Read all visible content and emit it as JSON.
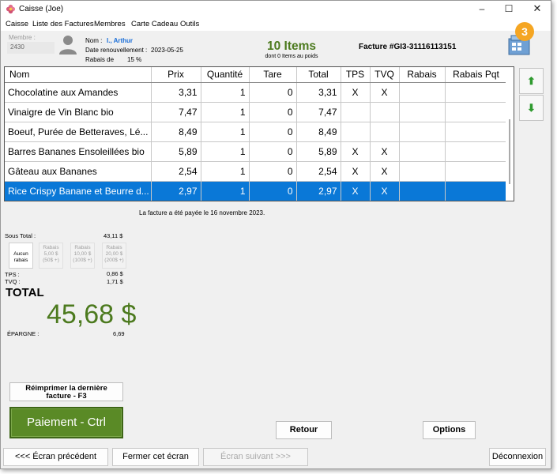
{
  "window": {
    "title": "Caisse (Joe)",
    "minimize": "–",
    "maximize": "☐",
    "close": "✕"
  },
  "menu": [
    "Caisse",
    "Liste des Factures",
    "Membres",
    "Carte Cadeau",
    "Outils"
  ],
  "member": {
    "label": "Membre :",
    "number": "2430",
    "name_label": "Nom :",
    "name": "I., Arthur",
    "renewal_label": "Date renouvellement :",
    "renewal": "2023-05-25",
    "discount_label": "Rabais de",
    "discount": "15 %"
  },
  "summary": {
    "items": "10 Items",
    "items_sub": "dont 0 Items au poids",
    "invoice": "Facture #GI3-31116113151"
  },
  "badge": "3",
  "table": {
    "headers": [
      "Nom",
      "Prix",
      "Quantité",
      "Tare",
      "Total",
      "TPS",
      "TVQ",
      "Rabais",
      "Rabais Pqt"
    ],
    "rows": [
      {
        "name": "Chocolatine aux Amandes",
        "price": "3,31",
        "qty": "1",
        "tare": "0",
        "total": "3,31",
        "tps": "X",
        "tvq": "X",
        "rabais": "",
        "rabais_pqt": ""
      },
      {
        "name": "Vinaigre de Vin Blanc bio",
        "price": "7,47",
        "qty": "1",
        "tare": "0",
        "total": "7,47",
        "tps": "",
        "tvq": "",
        "rabais": "",
        "rabais_pqt": ""
      },
      {
        "name": "Boeuf, Purée de Betteraves, Lé...",
        "price": "8,49",
        "qty": "1",
        "tare": "0",
        "total": "8,49",
        "tps": "",
        "tvq": "",
        "rabais": "",
        "rabais_pqt": ""
      },
      {
        "name": "Barres Bananes Ensoleillées bio",
        "price": "5,89",
        "qty": "1",
        "tare": "0",
        "total": "5,89",
        "tps": "X",
        "tvq": "X",
        "rabais": "",
        "rabais_pqt": ""
      },
      {
        "name": "Gâteau aux Bananes",
        "price": "2,54",
        "qty": "1",
        "tare": "0",
        "total": "2,54",
        "tps": "X",
        "tvq": "X",
        "rabais": "",
        "rabais_pqt": ""
      },
      {
        "name": "Rice Crispy Banane et Beurre d...",
        "price": "2,97",
        "qty": "1",
        "tare": "0",
        "total": "2,97",
        "tps": "X",
        "tvq": "X",
        "rabais": "",
        "rabais_pqt": ""
      }
    ],
    "selected_index": 5
  },
  "scroll_up": "⬆",
  "scroll_down": "⬇",
  "paid_message": "La facture a été payée le 16 novembre 2023.",
  "totals": {
    "subtotal_label": "Sous Total :",
    "subtotal": "43,11 $",
    "tps_label": "TPS :",
    "tps": "0,86 $",
    "tvq_label": "TVQ :",
    "tvq": "1,71 $",
    "total_label": "TOTAL",
    "total": "45,68 $",
    "savings_label": "ÉPARGNE :",
    "savings": "6,69"
  },
  "discount_buttons": [
    {
      "line1": "Aucun",
      "line2": "rabais",
      "line3": ""
    },
    {
      "line1": "Rabais",
      "line2": "5,00 $",
      "line3": "(50$ +)"
    },
    {
      "line1": "Rabais",
      "line2": "10,00 $",
      "line3": "(100$ +)"
    },
    {
      "line1": "Rabais",
      "line2": "20,00 $",
      "line3": "(200$ +)"
    }
  ],
  "buttons": {
    "reprint_line1": "Réimprimer la dernière",
    "reprint_line2": "facture - F3",
    "pay": "Paiement - Ctrl",
    "retour": "Retour",
    "options": "Options",
    "prev": "<<< Écran précédent",
    "close_screen": "Fermer cet écran",
    "next": "Écran suivant >>>",
    "logout": "Déconnexion"
  },
  "colors": {
    "accent_green": "#4c7a1e",
    "selection_blue": "#0a78d7",
    "badge_orange": "#f5a623",
    "pay_button": "#5a8a26"
  }
}
